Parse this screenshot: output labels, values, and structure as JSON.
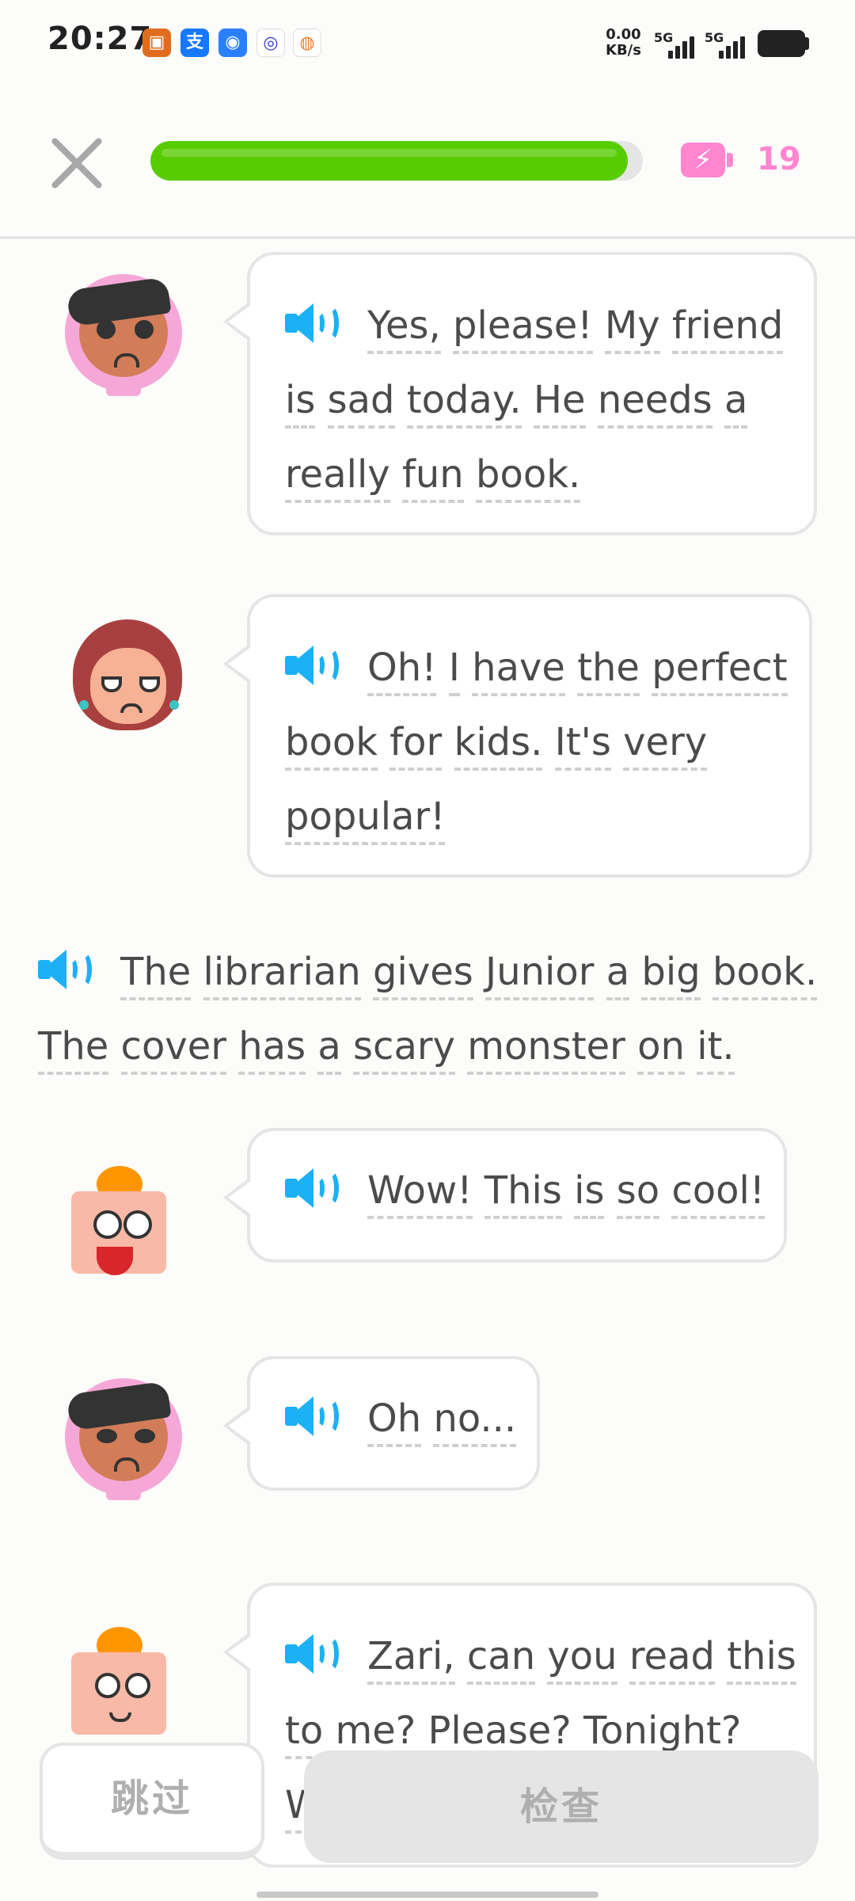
{
  "status_bar": {
    "time": "20:27",
    "net_speed_value": "0.00",
    "net_speed_unit": "KB/s",
    "signal_1": "5G",
    "signal_2": "5G",
    "app_icons": [
      "app-icon-1",
      "alipay-icon",
      "app-icon-3",
      "app-icon-4",
      "app-icon-5"
    ]
  },
  "header": {
    "progress": 0.97,
    "energy_count": "19",
    "colors": {
      "progress": "#58cc02",
      "energy": "#ff86d0",
      "speaker": "#1cb0f6"
    }
  },
  "dialogue": [
    {
      "speaker": "zari",
      "lines": [
        [
          "Yes,",
          "please!",
          "My",
          "friend"
        ],
        [
          "is",
          "sad",
          "today.",
          "He",
          "needs",
          "a"
        ],
        [
          "really",
          "fun",
          "book."
        ]
      ]
    },
    {
      "speaker": "librarian",
      "lines": [
        [
          "Oh!",
          "I",
          "have",
          "the",
          "perfect"
        ],
        [
          "book",
          "for",
          "kids.",
          "It's",
          "very"
        ],
        [
          "popular!"
        ]
      ]
    },
    {
      "speaker": "narrator",
      "lines": [
        [
          "The",
          "librarian",
          "gives",
          "Junior",
          "a",
          "big",
          "book."
        ],
        [
          "The",
          "cover",
          "has",
          "a",
          "scary",
          "monster",
          "on",
          "it."
        ]
      ]
    },
    {
      "speaker": "junior",
      "lines": [
        [
          "Wow!",
          "This",
          "is",
          "so",
          "cool!"
        ]
      ]
    },
    {
      "speaker": "zari",
      "lines": [
        [
          "Oh",
          "no..."
        ]
      ]
    },
    {
      "speaker": "junior",
      "lines": [
        [
          "Zari,",
          "can",
          "you",
          "read",
          "this"
        ],
        [
          "to",
          "me?",
          "Please?",
          "Tonight?"
        ],
        [
          "W"
        ]
      ]
    }
  ],
  "footer": {
    "skip_label": "跳过",
    "check_label": "检查"
  }
}
